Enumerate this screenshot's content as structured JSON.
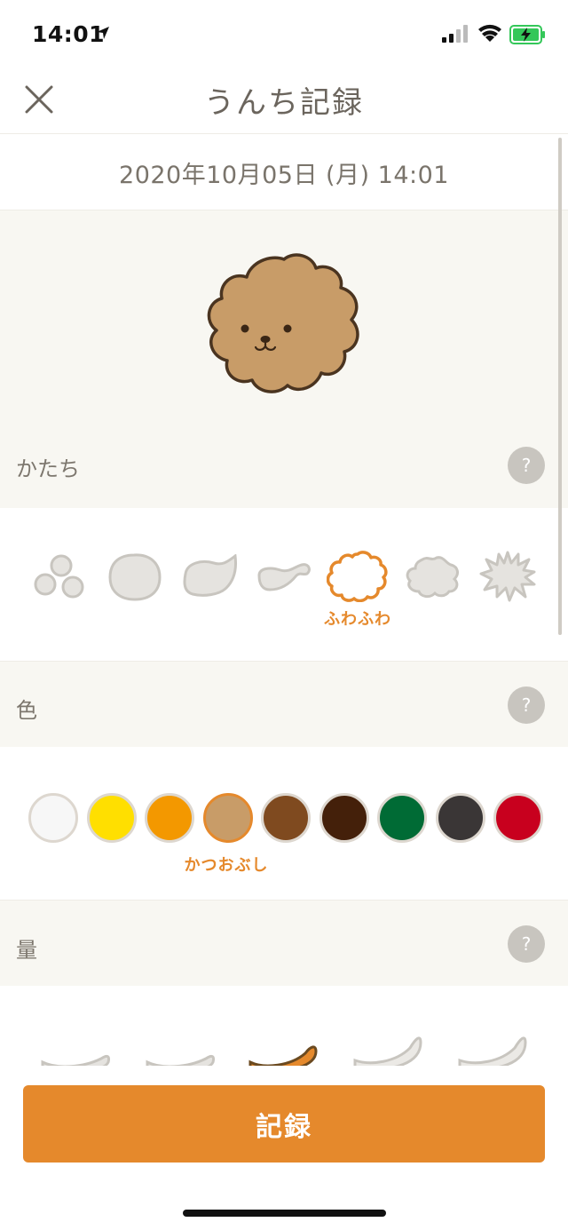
{
  "status": {
    "time": "14:01"
  },
  "header": {
    "title": "うんち記録"
  },
  "record": {
    "datetime": "2020年10月05日 (月) 14:01"
  },
  "shape": {
    "label": "かたち",
    "help": "?",
    "selected_label": "ふわふわ"
  },
  "color": {
    "label": "色",
    "help": "?",
    "selected_label": "かつおぶし",
    "swatches": [
      "#f7f7f7",
      "#ffdf00",
      "#f39800",
      "#c89c68",
      "#7f4a1f",
      "#44200a",
      "#006b35",
      "#3a3636",
      "#c8001e"
    ]
  },
  "amount": {
    "label": "量",
    "help": "?"
  },
  "footer": {
    "record_button": "記録"
  }
}
